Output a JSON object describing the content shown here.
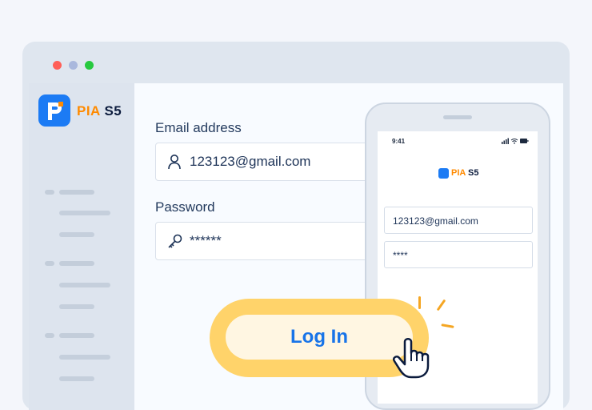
{
  "brand": {
    "name_prefix": "PIA",
    "name_suffix": "S5",
    "primary_color": "#1c7bf4",
    "accent_color": "#ff8a00"
  },
  "login_form": {
    "email_label": "Email address",
    "email_value": "123123@gmail.com",
    "email_icon": "user-icon",
    "password_label": "Password",
    "password_value": "******",
    "password_icon": "key-icon",
    "login_label": "Log In",
    "login_highlight_color": "#ffd36a"
  },
  "phone": {
    "status_time": "9:41",
    "status_icons": "signal wifi battery",
    "brand_prefix": "PIA",
    "brand_suffix": "S5",
    "email_value": "123123@gmail.com",
    "password_value": "****"
  },
  "window_controls": [
    "close",
    "minimize",
    "maximize"
  ]
}
